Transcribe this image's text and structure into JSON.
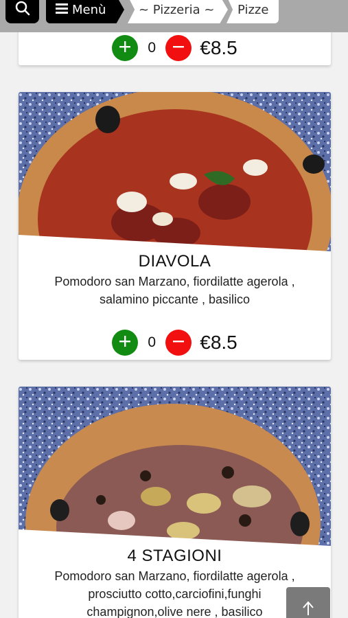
{
  "nav": {
    "search_icon": "search-icon",
    "menu_label": "Menù",
    "crumbs": [
      "~ Pizzeria ~",
      "Pizze"
    ]
  },
  "items": [
    {
      "qty": "0",
      "price": "€8.5"
    },
    {
      "name": "DIAVOLA",
      "description_lines": [
        "Pomodoro san Marzano, fiordilatte agerola ,",
        "salamino piccante , basilico"
      ],
      "qty": "0",
      "price": "€8.5"
    },
    {
      "name": "4 STAGIONI",
      "description_lines": [
        "Pomodoro san Marzano, fiordilatte agerola ,",
        "prosciutto cotto,carciofini,funghi",
        "champignon,olive nere , basilico"
      ]
    }
  ],
  "colors": {
    "plus": "#118b11",
    "minus": "#f20f0f",
    "nav_bg": "#a9a9a9"
  },
  "back_to_top_icon": "arrow-up-icon"
}
